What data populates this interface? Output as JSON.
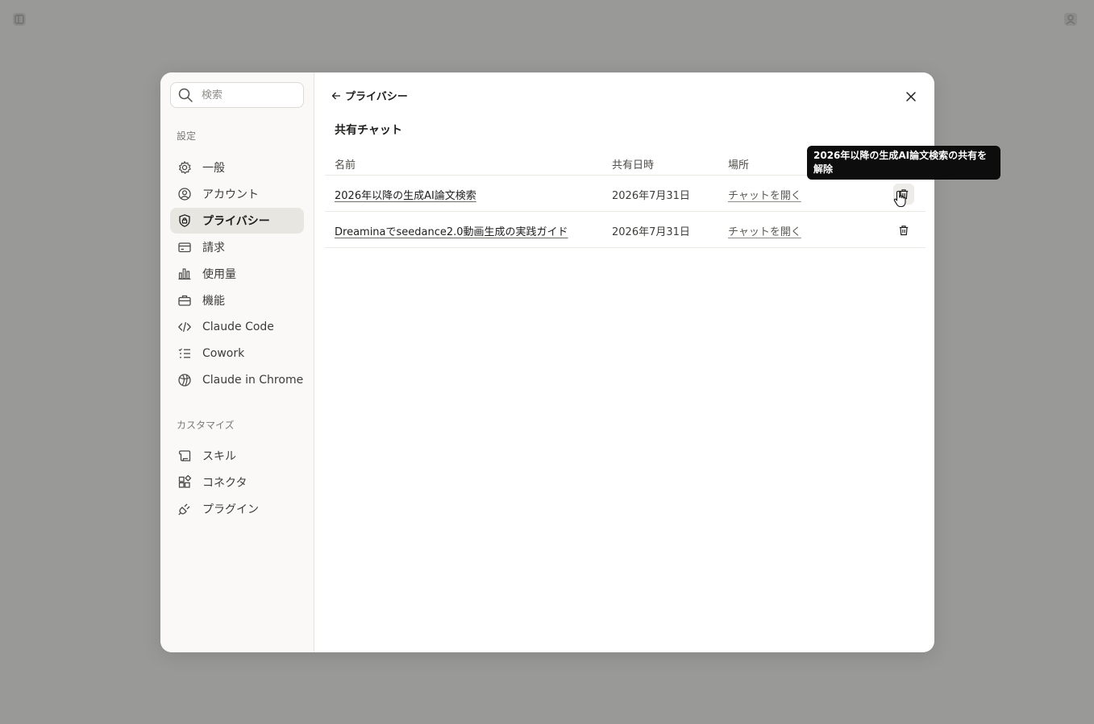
{
  "search": {
    "placeholder": "検索"
  },
  "sidebar": {
    "section_settings": "設定",
    "section_customize": "カスタマイズ",
    "settings_items": [
      {
        "label": "一般",
        "icon": "gear-icon"
      },
      {
        "label": "アカウント",
        "icon": "user-circle-icon"
      },
      {
        "label": "プライバシー",
        "icon": "shield-lock-icon",
        "active": true
      },
      {
        "label": "請求",
        "icon": "credit-card-icon"
      },
      {
        "label": "使用量",
        "icon": "bar-chart-icon"
      },
      {
        "label": "機能",
        "icon": "briefcase-icon"
      },
      {
        "label": "Claude Code",
        "icon": "code-icon"
      },
      {
        "label": "Cowork",
        "icon": "checklist-icon"
      },
      {
        "label": "Claude in Chrome",
        "icon": "globe-icon"
      }
    ],
    "customize_items": [
      {
        "label": "スキル",
        "icon": "scroll-icon"
      },
      {
        "label": "コネクタ",
        "icon": "connector-icon"
      },
      {
        "label": "プラグイン",
        "icon": "plug-icon"
      }
    ]
  },
  "header": {
    "back_label": "プライバシー",
    "title": "共有チャット"
  },
  "table": {
    "columns": {
      "name": "名前",
      "date": "共有日時",
      "location": "場所"
    },
    "rows": [
      {
        "name": "2026年以降の生成AI論文検索",
        "date": "2026年7月31日",
        "location": "チャットを開く"
      },
      {
        "name": "Dreaminaでseedance2.0動画生成の実践ガイド",
        "date": "2026年7月31日",
        "location": "チャットを開く"
      }
    ]
  },
  "tooltip": {
    "text": "2026年以降の生成AI論文検索の共有を解除"
  },
  "colors": {
    "backdrop": "#999998",
    "modal": "#ffffff",
    "sidebar": "#faf9f7",
    "active_item": "#e8e6e1",
    "tooltip": "#0d0d0d"
  }
}
